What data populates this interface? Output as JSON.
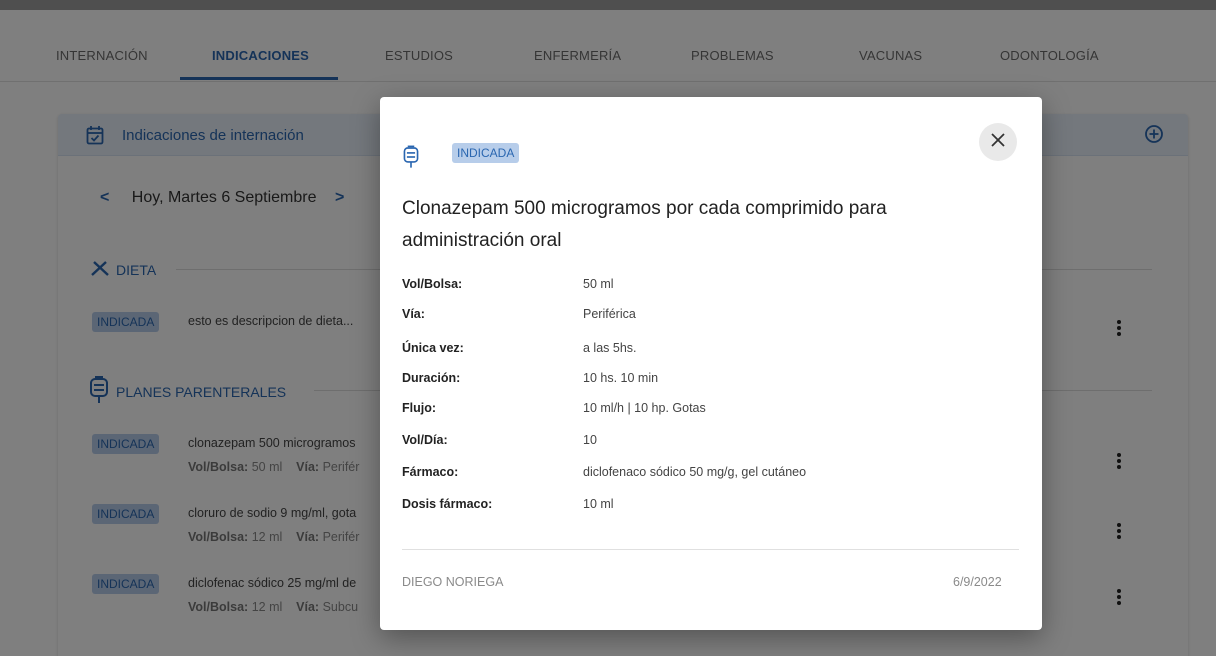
{
  "tabs": [
    "INTERNACIÓN",
    "INDICACIONES",
    "ESTUDIOS",
    "ENFERMERÍA",
    "PROBLEMAS",
    "VACUNAS",
    "ODONTOLOGÍA"
  ],
  "card": {
    "title": "Indicaciones de internación",
    "date_prefix": "Hoy,",
    "date": "Martes 6 Septiembre"
  },
  "sections": {
    "diet_title": "DIETA",
    "parenteral_title": "PLANES PARENTERALES"
  },
  "diet_row": {
    "badge": "INDICADA",
    "text": "esto es descripcion de dieta..."
  },
  "parenteral_rows": [
    {
      "badge": "INDICADA",
      "text": "clonazepam 500 microgramos",
      "sub_label1": "Vol/Bolsa:",
      "sub_value1": "50 ml",
      "sub_label2": "Vía:",
      "sub_value2": "Perifér"
    },
    {
      "badge": "INDICADA",
      "text": "cloruro de sodio 9 mg/ml, gota",
      "sub_label1": "Vol/Bolsa:",
      "sub_value1": "12 ml",
      "sub_label2": "Vía:",
      "sub_value2": "Perifér"
    },
    {
      "badge": "INDICADA",
      "text": "diclofenac sódico 25 mg/ml de",
      "sub_label1": "Vol/Bolsa:",
      "sub_value1": "12 ml",
      "sub_label2": "Vía:",
      "sub_value2": "Subcu"
    }
  ],
  "modal": {
    "badge": "INDICADA",
    "heading": "Clonazepam 500 microgramos por cada comprimido para administración oral",
    "fields": [
      {
        "label": "Vol/Bolsa:",
        "value": "50 ml"
      },
      {
        "label": "Vía:",
        "value": "Periférica"
      },
      {
        "label": "Única vez:",
        "value": "a las 5hs."
      },
      {
        "label": "Duración:",
        "value": "10 hs. 10 min"
      },
      {
        "label": "Flujo:",
        "value": "10 ml/h | 10 hp. Gotas"
      },
      {
        "label": "Vol/Día:",
        "value": "10"
      },
      {
        "label": "Fármaco:",
        "value": "diclofenaco sódico 50 mg/g, gel cutáneo"
      },
      {
        "label": "Dosis fármaco:",
        "value": "10 ml"
      }
    ],
    "author": "DIEGO NORIEGA",
    "date": "6/9/2022"
  },
  "colors": {
    "primary": "#2a66b0",
    "badge_bg": "#b7cdea"
  }
}
